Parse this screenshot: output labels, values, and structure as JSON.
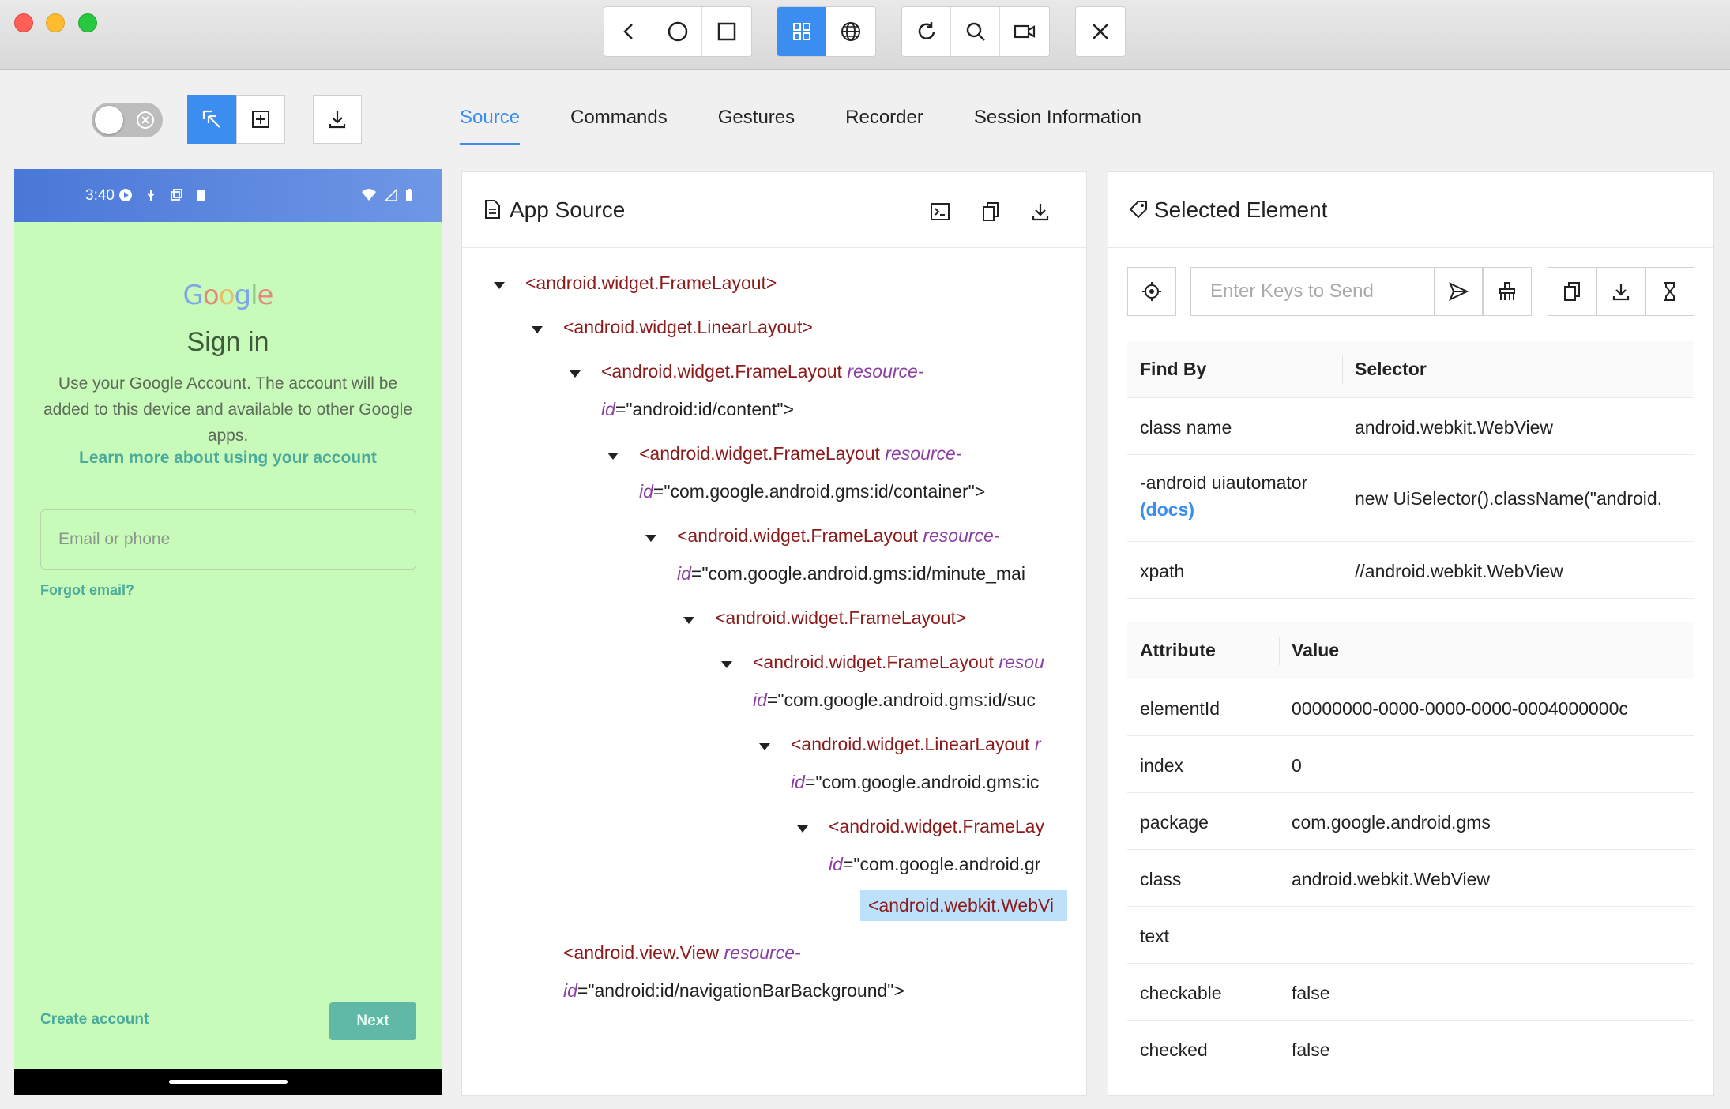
{
  "window": {
    "toolbar_groups": [
      {
        "buttons": [
          {
            "name": "back-icon"
          },
          {
            "name": "home-icon"
          },
          {
            "name": "app-switch-icon"
          }
        ]
      },
      {
        "buttons": [
          {
            "name": "native-mode-icon",
            "active": true
          },
          {
            "name": "web-mode-icon"
          }
        ]
      },
      {
        "buttons": [
          {
            "name": "refresh-icon"
          },
          {
            "name": "search-icon"
          },
          {
            "name": "record-icon"
          }
        ]
      },
      {
        "buttons": [
          {
            "name": "close-icon"
          }
        ]
      }
    ]
  },
  "tabs": [
    {
      "label": "Source",
      "active": true
    },
    {
      "label": "Commands"
    },
    {
      "label": "Gestures"
    },
    {
      "label": "Recorder"
    },
    {
      "label": "Session Information"
    }
  ],
  "phone": {
    "time": "3:40",
    "logo": "Google",
    "title": "Sign in",
    "subtext": "Use your Google Account. The account will be added to this device and available to other Google apps.",
    "learn_more": "Learn more about using your account",
    "email_placeholder": "Email or phone",
    "forgot_email": "Forgot email?",
    "create_account": "Create account",
    "next": "Next"
  },
  "app_source": {
    "title": "App Source",
    "nodes": [
      {
        "l1": "<android.widget.FrameLayout>"
      },
      {
        "l1": "<android.widget.LinearLayout>"
      },
      {
        "tag": "<android.widget.FrameLayout",
        "attr1": "resource-",
        "attr2": "id",
        "val": "=\"android:id/content\">"
      },
      {
        "tag": "<android.widget.FrameLayout",
        "attr1": "resource-",
        "attr2": "id",
        "val": "=\"com.google.android.gms:id/container\">"
      },
      {
        "tag": "<android.widget.FrameLayout",
        "attr1": "resource-",
        "attr2": "id",
        "val": "=\"com.google.android.gms:id/minute_mai"
      },
      {
        "l1": "<android.widget.FrameLayout>"
      },
      {
        "tag": "<android.widget.FrameLayout",
        "attr1": "resou",
        "attr2": "id",
        "val": "=\"com.google.android.gms:id/suc"
      },
      {
        "tag": "<android.widget.LinearLayout",
        "attr1": "r",
        "attr2": "id",
        "val": "=\"com.google.android.gms:ic"
      },
      {
        "tag": "<android.widget.FrameLay",
        "attr1": "",
        "attr2": "id",
        "val": "=\"com.google.android.gr"
      },
      {
        "l1": "<android.webkit.WebVi"
      },
      {
        "tag": "<android.view.View",
        "attr1": "resource-",
        "attr2": "id",
        "val": "=\"android:id/navigationBarBackground\">"
      }
    ]
  },
  "selected_element": {
    "title": "Selected Element",
    "keys_placeholder": "Enter Keys to Send",
    "find_headers": [
      "Find By",
      "Selector"
    ],
    "find_rows": [
      {
        "by": "class name",
        "selector": "android.webkit.WebView"
      },
      {
        "by": "-android uiautomator",
        "docs": "(docs)",
        "selector": "new UiSelector().className(\"android."
      },
      {
        "by": "xpath",
        "selector": "//android.webkit.WebView"
      }
    ],
    "attr_headers": [
      "Attribute",
      "Value"
    ],
    "attr_rows": [
      {
        "name": "elementId",
        "value": "00000000-0000-0000-0000-0004000000c"
      },
      {
        "name": "index",
        "value": "0"
      },
      {
        "name": "package",
        "value": "com.google.android.gms"
      },
      {
        "name": "class",
        "value": "android.webkit.WebView"
      },
      {
        "name": "text",
        "value": ""
      },
      {
        "name": "checkable",
        "value": "false"
      },
      {
        "name": "checked",
        "value": "false"
      }
    ]
  },
  "colors": {
    "accent": "#3b8ef0",
    "phone_bg": "#c8fbb9",
    "tag": "#8b1a1a",
    "attr": "#8a3fa3",
    "selected_node": "#bde0fb"
  }
}
